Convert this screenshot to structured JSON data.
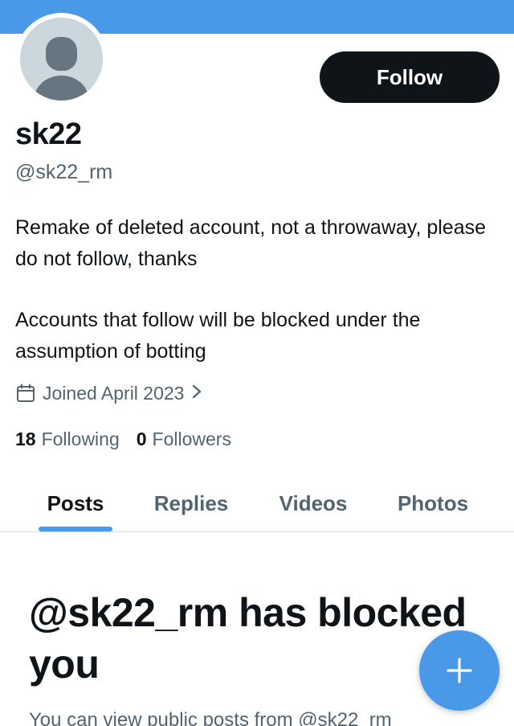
{
  "profile": {
    "display_name": "sk22",
    "handle": "@sk22_rm",
    "bio_line1": "Remake of deleted account, not a throwaway, please do not follow, thanks",
    "bio_line2": "Accounts that follow will be blocked under the assumption of botting",
    "joined": "Joined April 2023",
    "following_count": "18",
    "following_label": "Following",
    "followers_count": "0",
    "followers_label": "Followers"
  },
  "actions": {
    "follow_label": "Follow",
    "compose_icon": "plus-icon"
  },
  "tabs": [
    {
      "label": "Posts",
      "active": true
    },
    {
      "label": "Replies",
      "active": false
    },
    {
      "label": "Videos",
      "active": false
    },
    {
      "label": "Photos",
      "active": false
    }
  ],
  "blocked": {
    "title": "@sk22_rm has blocked you",
    "subtitle": "You can view public posts from @sk22_rm"
  },
  "colors": {
    "accent": "#4a99e9",
    "primary_text": "#0f1419",
    "secondary_text": "#536471",
    "button_bg": "#0f1419",
    "avatar_bg": "#ccd6dd"
  },
  "icons": {
    "calendar": "calendar-icon",
    "chevron": "chevron-right-icon",
    "avatar": "default-avatar-icon"
  }
}
